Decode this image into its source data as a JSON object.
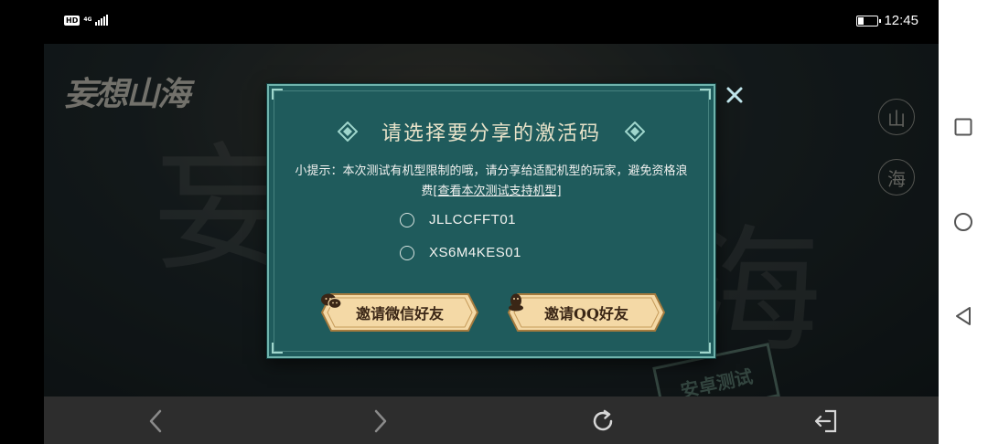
{
  "status_bar": {
    "hd_badge": "HD",
    "network": "4G",
    "time": "12:45",
    "battery_level": 0.25
  },
  "game": {
    "logo_text": "妄想山海",
    "side_seals": [
      "山",
      "海"
    ],
    "watermark_chars": [
      "妄",
      "海"
    ],
    "stamp_text": "安卓测试"
  },
  "modal": {
    "title": "请选择要分享的激活码",
    "tip_text": "小提示：本次测试有机型限制的哦，请分享给适配机型的玩家，避免资格浪费",
    "tip_link": "[查看本次测试支持机型]",
    "codes": [
      "JLLCCFFT01",
      "XS6M4KES01"
    ],
    "buttons": {
      "wechat": "邀请微信好友",
      "qq": "邀请QQ好友"
    }
  },
  "colors": {
    "modal_bg": "#1f5b5c",
    "modal_border": "#6fb3ac",
    "button_gold": "#f4d9a6",
    "title_text": "#e7e2c9"
  }
}
